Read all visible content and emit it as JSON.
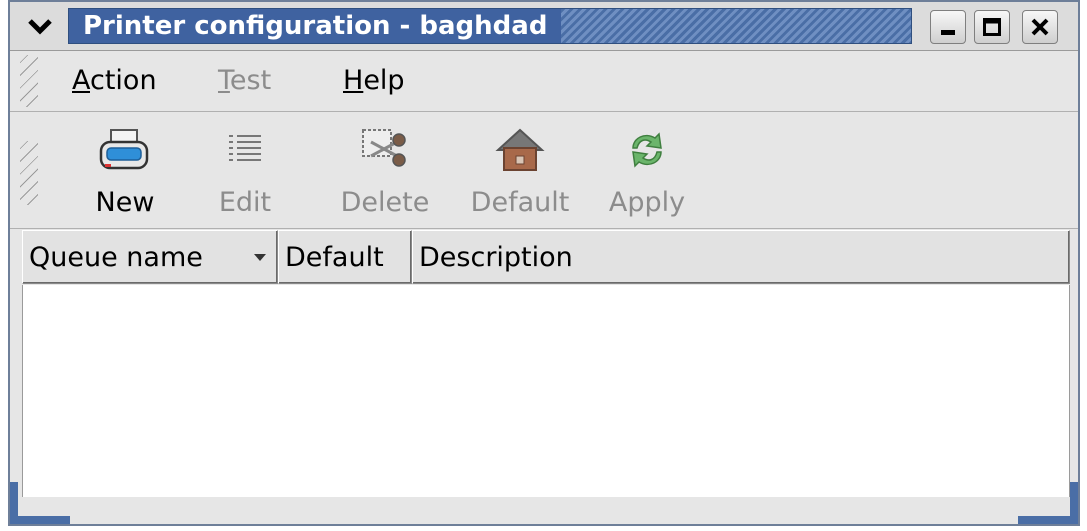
{
  "window": {
    "title": "Printer configuration - baghdad"
  },
  "menubar": {
    "items": [
      {
        "pre": "",
        "mnemonic": "A",
        "post": "ction",
        "enabled": true
      },
      {
        "pre": "",
        "mnemonic": "T",
        "post": "est",
        "enabled": false
      },
      {
        "pre": "",
        "mnemonic": "H",
        "post": "elp",
        "enabled": true
      }
    ]
  },
  "toolbar": {
    "items": [
      {
        "label": "New",
        "icon": "printer-icon",
        "enabled": true
      },
      {
        "label": "Edit",
        "icon": "edit-list-icon",
        "enabled": false
      },
      {
        "label": "Delete",
        "icon": "scissors-delete-icon",
        "enabled": false
      },
      {
        "label": "Default",
        "icon": "house-icon",
        "enabled": false
      },
      {
        "label": "Apply",
        "icon": "refresh-arrows-icon",
        "enabled": false
      }
    ]
  },
  "table": {
    "columns": [
      "Queue name",
      "Default",
      "Description"
    ],
    "sort_column": "Queue name",
    "rows": []
  },
  "colors": {
    "title_bar": "#3f62a0",
    "window_bg": "#e6e6e6",
    "disabled_text": "#8c8c8c"
  }
}
